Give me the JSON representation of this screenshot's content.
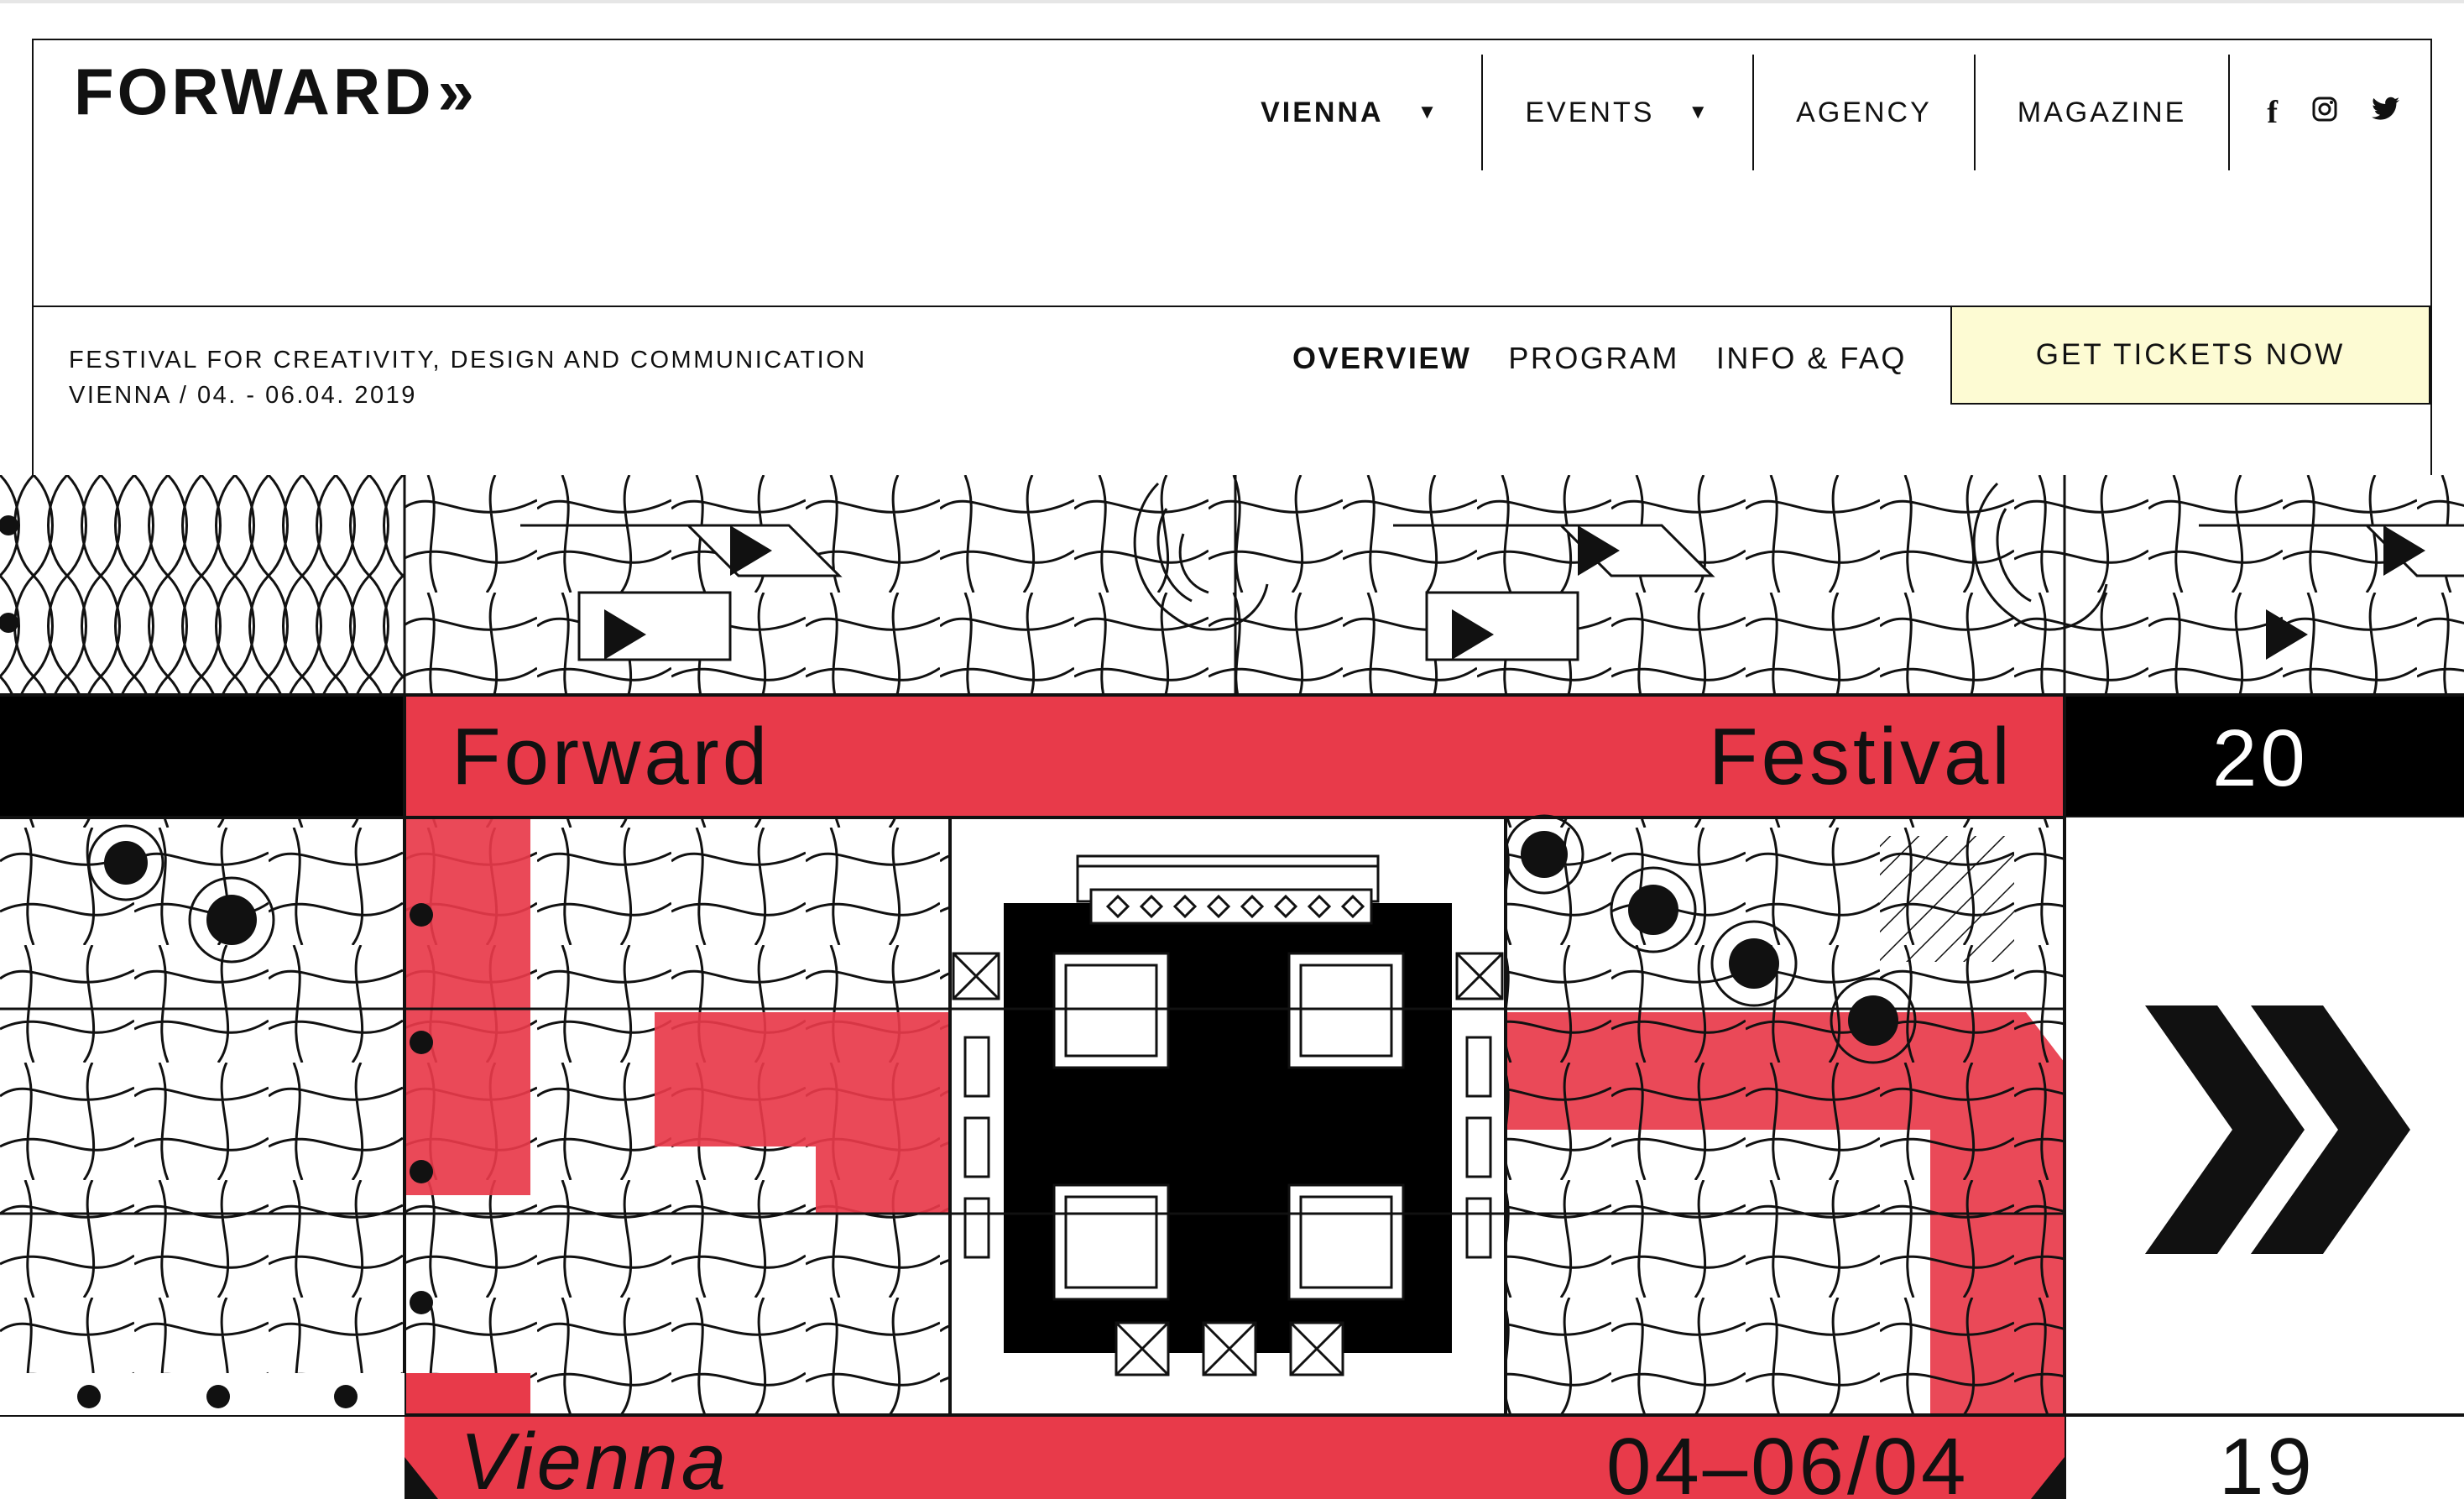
{
  "logo": {
    "text": "FORWARD",
    "chevrons": "»"
  },
  "nav": {
    "items": [
      {
        "label": "VIENNA",
        "dropdown": true,
        "active": true
      },
      {
        "label": "EVENTS",
        "dropdown": true,
        "active": false
      },
      {
        "label": "AGENCY",
        "dropdown": false,
        "active": false
      },
      {
        "label": "MAGAZINE",
        "dropdown": false,
        "active": false
      }
    ],
    "social": [
      {
        "icon": "facebook-icon",
        "glyph": "f"
      },
      {
        "icon": "instagram-icon",
        "glyph": "◎"
      },
      {
        "icon": "twitter-icon",
        "glyph": "🐦"
      }
    ]
  },
  "subheader": {
    "tagline_line1": "FESTIVAL FOR CREATIVITY, DESIGN AND COMMUNICATION",
    "tagline_line2": "VIENNA / 04. - 06.04. 2019",
    "tabs": [
      {
        "label": "OVERVIEW",
        "active": true
      },
      {
        "label": "PROGRAM",
        "active": false
      },
      {
        "label": "INFO & FAQ",
        "active": false
      }
    ],
    "cta": "GET TICKETS NOW"
  },
  "hero": {
    "word_forward": "Forward",
    "word_festival": "Festival",
    "year_top": "20",
    "word_vienna": "Vienna",
    "dates": "04–06/04",
    "year_bottom": "19"
  },
  "colors": {
    "accent": "#e83a4a",
    "ink": "#111111",
    "cta_bg": "#fdfbd3"
  }
}
